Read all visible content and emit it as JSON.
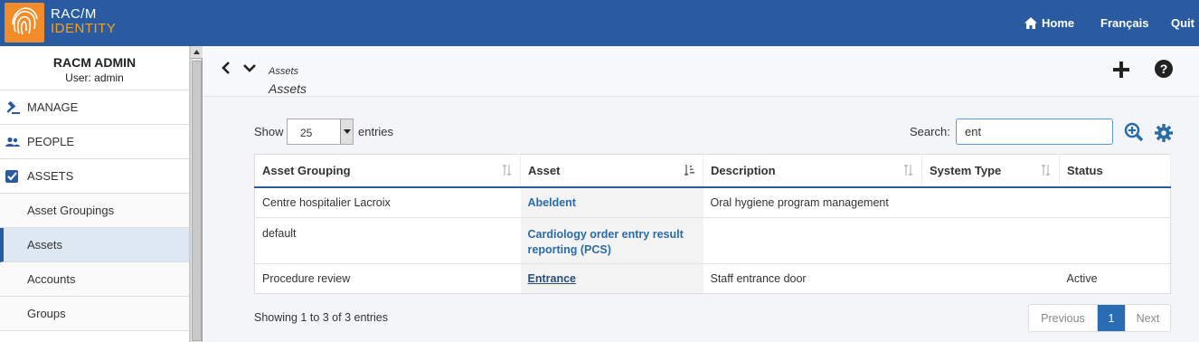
{
  "header": {
    "logo_line1": "RAC/M",
    "logo_line2": "IDENTITY",
    "nav": {
      "home": "Home",
      "french": "Français",
      "quit": "Quit"
    }
  },
  "sidebar": {
    "title": "RACM ADMIN",
    "user": "User: admin",
    "items": [
      {
        "label": "MANAGE",
        "icon": "gavel-icon"
      },
      {
        "label": "PEOPLE",
        "icon": "people-icon"
      },
      {
        "label": "ASSETS",
        "icon": "checkbox-icon"
      }
    ],
    "sub_items": [
      {
        "label": "Asset Groupings"
      },
      {
        "label": "Assets",
        "active": true
      },
      {
        "label": "Accounts"
      },
      {
        "label": "Groups"
      }
    ]
  },
  "breadcrumb": {
    "small": "Assets",
    "title": "Assets"
  },
  "controls": {
    "show_label": "Show",
    "page_size": "25",
    "entries_label": "entries",
    "search_label": "Search:",
    "search_value": "ent"
  },
  "table": {
    "columns": [
      "Asset Grouping",
      "Asset",
      "Description",
      "System Type",
      "Status"
    ],
    "rows": [
      {
        "grouping": "Centre hospitalier Lacroix",
        "asset": "Abeldent",
        "description": "Oral hygiene program management",
        "system_type": "",
        "status": ""
      },
      {
        "grouping": "default",
        "asset_line1": "Cardiology order entry result",
        "asset_line2": "reporting (PCS)",
        "description": "",
        "system_type": "",
        "status": ""
      },
      {
        "grouping": "Procedure review",
        "asset": "Entrance",
        "description": "Staff entrance door",
        "system_type": "",
        "status": "Active"
      }
    ]
  },
  "footer": {
    "info": "Showing 1 to 3 of 3 entries",
    "prev": "Previous",
    "page": "1",
    "next": "Next"
  },
  "colors": {
    "header_bg": "#2a5ba0",
    "logo_orange": "#f28c28",
    "link": "#2a6ca8",
    "active_page": "#2a6cb4"
  }
}
